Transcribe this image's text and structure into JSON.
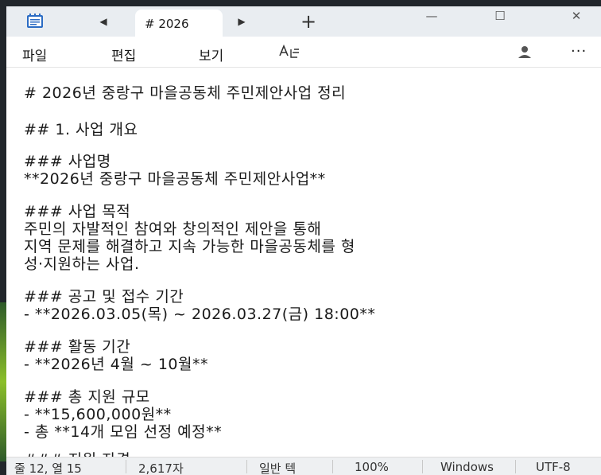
{
  "tab": {
    "title": "# 2026",
    "prev_symbol": "◀",
    "next_symbol": "▶",
    "new_symbol": "+"
  },
  "window_controls": {
    "minimize": "—",
    "maximize": "☐",
    "close": "✕"
  },
  "menu": {
    "file": "파일",
    "edit": "편집",
    "view": "보기",
    "more": "···"
  },
  "editor": {
    "lines": [
      "# 2026년 중랑구 마을공동체 주민제안사업 정리",
      "## 1. 사업 개요",
      "### 사업명",
      "**2026년 중랑구 마을공동체 주민제안사업**",
      "### 사업 목적",
      "주민의 자발적인 참여와 창의적인 제안을 통해",
      "지역 문제를 해결하고 지속 가능한 마을공동체를 형",
      "성·지원하는 사업.",
      "### 공고 및 접수 기간",
      "- **2026.03.05(목) ~ 2026.03.27(금) 18:00**",
      "### 활동 기간",
      "- **2026년 4월 ~ 10월**",
      "### 총 지원 규모",
      "- **15,600,000원**",
      "- 총 **14개 모임 선정 예정**",
      "### 지원 자격"
    ]
  },
  "status": {
    "position": "줄 12, 열 15",
    "chars": "2,617자",
    "format": "일반 텍",
    "zoom": "100%",
    "line_ending": "Windows",
    "encoding": "UTF-8"
  },
  "colors": {
    "titlebar": "#e9edf1",
    "statusbar": "#eef0f2",
    "desktop": "#21262b",
    "accent": "#8bbf2a"
  }
}
